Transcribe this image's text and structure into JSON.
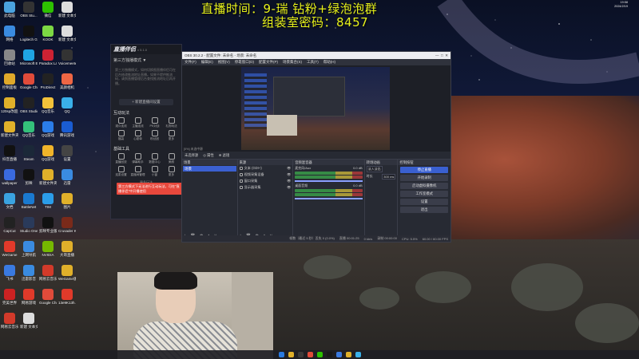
{
  "overlay": {
    "line1": "直播时间：9-瑞          钻粉+绿泡泡群",
    "line2": "组装室密码：8457"
  },
  "desktop_icons": [
    {
      "label": "此电脑",
      "color": "#4aa3df"
    },
    {
      "label": "OBS Stu...",
      "color": "#333"
    },
    {
      "label": "微信",
      "color": "#2dc100"
    },
    {
      "label": "新建 文本文档",
      "color": "#ddd"
    },
    {
      "label": "网络",
      "color": "#3a8be0"
    },
    {
      "label": "Logitech G HUB",
      "color": "#111"
    },
    {
      "label": "KOOK",
      "color": "#7cd843"
    },
    {
      "label": "新建 文本文档",
      "color": "#ddd"
    },
    {
      "label": "回收站",
      "color": "#888"
    },
    {
      "label": "Microsoft Edge",
      "color": "#1fa5e3"
    },
    {
      "label": "Paradox Launcher v2",
      "color": "#c23"
    },
    {
      "label": "Voicemeeter",
      "color": "#333"
    },
    {
      "label": "控制面板",
      "color": "#e0a92a"
    },
    {
      "label": "Google Chrome",
      "color": "#e04b3a"
    },
    {
      "label": "ProDirect",
      "color": "#222"
    },
    {
      "label": "美颜相机",
      "color": "#e64"
    },
    {
      "label": "120sp改超分",
      "color": "#e0b02a"
    },
    {
      "label": "OBS Studio",
      "color": "#222"
    },
    {
      "label": "QQ音乐",
      "color": "#f3c23a"
    },
    {
      "label": "QQ",
      "color": "#3ab0e9"
    },
    {
      "label": "新建文件夹",
      "color": "#e0b02a"
    },
    {
      "label": "QQ音乐",
      "color": "#34c07a"
    },
    {
      "label": "QQ游戏",
      "color": "#2b7de9"
    },
    {
      "label": "腾讯游戏",
      "color": "#1a5cd2"
    },
    {
      "label": "抖音直播",
      "color": "#111"
    },
    {
      "label": "Steam",
      "color": "#1b2838"
    },
    {
      "label": "QQ游戏",
      "color": "#f0b42a"
    },
    {
      "label": "设置",
      "color": "#444"
    },
    {
      "label": "wallpaper",
      "color": "#3a6ae0"
    },
    {
      "label": "剪映",
      "color": "#111"
    },
    {
      "label": "新建文件夹",
      "color": "#e0b02a"
    },
    {
      "label": "迅雷",
      "color": "#3a8be0"
    },
    {
      "label": "文档",
      "color": "#3aa3e0"
    },
    {
      "label": "BattleNet",
      "color": "#1a7ad0"
    },
    {
      "label": "TIM",
      "color": "#2b9de9"
    },
    {
      "label": "图片",
      "color": "#e0b02a"
    },
    {
      "label": "CapCut",
      "color": "#222"
    },
    {
      "label": "Studio One",
      "color": "#2a3a5a"
    },
    {
      "label": "剪映专业版",
      "color": "#111"
    },
    {
      "label": "Crusader Kings III",
      "color": "#7a2a1a"
    },
    {
      "label": "WeGame",
      "color": "#e23a2a"
    },
    {
      "label": "上网导航",
      "color": "#3a8be0"
    },
    {
      "label": "NVIDIA",
      "color": "#76b900"
    },
    {
      "label": "大哥直播",
      "color": "#e0b02a"
    },
    {
      "label": "飞书",
      "color": "#3a7ae0"
    },
    {
      "label": "迅雷影音",
      "color": "#3a8be0"
    },
    {
      "label": "网易云音乐",
      "color": "#d23a2a"
    },
    {
      "label": "WeGame版",
      "color": "#e0b02a"
    },
    {
      "label": "完美世界",
      "color": "#c22"
    },
    {
      "label": "网易游戏",
      "color": "#e03a2a"
    },
    {
      "label": "Google Chrome",
      "color": "#e04b3a"
    },
    {
      "label": "13e9K13h...",
      "color": "#e03a2a"
    },
    {
      "label": "网易云音乐",
      "color": "#d23a2a"
    },
    {
      "label": "新建 文本文档",
      "color": "#ddd"
    }
  ],
  "zbbl": {
    "brand": "直播伴侣",
    "version": "v 5.1.0",
    "mode": "第三方独播模式 ▼",
    "tip": "第三方独播模式，如何切换图直播伴侣可在后台修改推流地址直播。如果不提供推流码，请到直播管理后台查找推流地址后再开播。",
    "add_button": "+ 新建直播间设置",
    "interaction_title": "互动玩法",
    "interaction_items": [
      "观众连线",
      "主播连线",
      "PK对战",
      "礼物玩法",
      "福袋",
      "心愿单",
      "粉丝团",
      "更多"
    ],
    "tools_title": "基础工具",
    "tools_items": [
      "直播回放",
      "弹幕助手",
      "数据中心",
      "美颜",
      "连麦设置",
      "直播间管理",
      "小窗",
      "更多"
    ],
    "more": "— 更多玩法 —",
    "toast": "第三方模式下无法进行互动玩法，可在\"直播伴侣\"中开播使用"
  },
  "obs": {
    "title": "OBS 30.2.2 - 配置文件: 未命名 - 场景: 未命名",
    "menu": [
      "文件(F)",
      "编辑(E)",
      "视图(V)",
      "停靠窗口(D)",
      "配置文件(P)",
      "场景集合(S)",
      "工具(T)",
      "帮助(H)"
    ],
    "preview_status": "[0%] 未选中源",
    "scene_bar": [
      "未选择源",
      "◎ 属性",
      "⊕ 滤镜"
    ],
    "docks": {
      "scenes_title": "场景",
      "scene_item": "场景",
      "sources_title": "来源",
      "sources": [
        "文本 (GDI+)",
        "视频采集设备",
        "窗口采集",
        "显示器采集"
      ],
      "mixer_title": "音频混音器",
      "mixer": [
        {
          "name": "麦克风/Aux",
          "db": "0.0 dB"
        },
        {
          "name": "桌面音频",
          "db": "0.0 dB"
        }
      ],
      "transitions_title": "转场动画",
      "transition_type": "淡入淡出",
      "duration_label": "时长",
      "duration": "300 ms",
      "controls_title": "控制按钮",
      "controls": [
        "停止直播",
        "开始录制",
        "启动虚拟摄像机",
        "工作室模式",
        "设置",
        "退出"
      ],
      "footer": "+ 🗑 ⚙ ˄ ˅"
    },
    "status": [
      "帧数（最近 5 秒）丢失 0 (0.0%)",
      "直播 00:01:25",
      "0 kb/s",
      "录制 00:00:00",
      "CPU: 5.5%",
      "60.00 / 60.00 FPS"
    ]
  },
  "taskbar": {
    "icons": [
      "#2a7ae0",
      "#e0b02a",
      "#3a3a3a",
      "#e04b3a",
      "#2dc100",
      "#1a1a1a",
      "#3a7ae0",
      "#e0b02a",
      "#3ab0e9"
    ],
    "time": "19:58",
    "date": "2024/2/19"
  }
}
